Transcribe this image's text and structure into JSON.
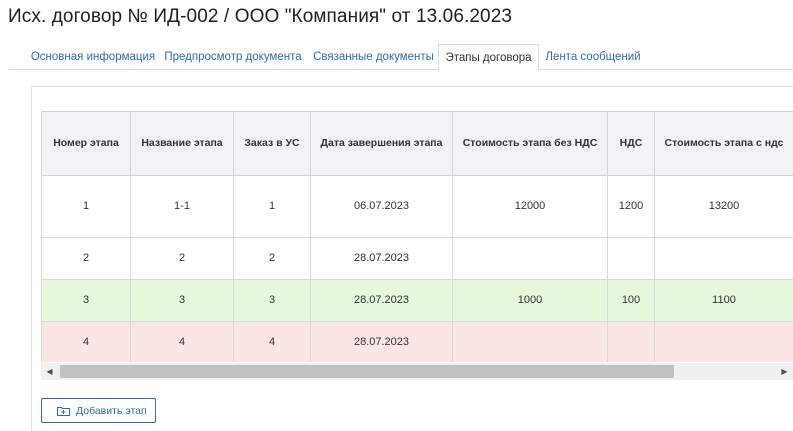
{
  "page": {
    "title": "Исх. договор № ИД-002 / ООО \"Компания\" от 13.06.2023"
  },
  "tabs": [
    {
      "label": "Основная информация",
      "active": false
    },
    {
      "label": "Предпросмотр документа",
      "active": false
    },
    {
      "label": "Связанные документы",
      "active": false
    },
    {
      "label": "Этапы договора",
      "active": true
    },
    {
      "label": "Лента сообщений",
      "active": false
    }
  ],
  "stages_table": {
    "columns": [
      "Номер этапа",
      "Название этапа",
      "Заказ в УС",
      "Дата завершения этапа",
      "Стоимость этапа без НДС",
      "НДС",
      "Стоимость этапа с ндс"
    ],
    "rows": [
      {
        "cells": [
          "1",
          "1-1",
          "1",
          "06.07.2023",
          "12000",
          "1200",
          "13200"
        ],
        "highlight": "none"
      },
      {
        "cells": [
          "2",
          "2",
          "2",
          "28.07.2023",
          "",
          "",
          ""
        ],
        "highlight": "none"
      },
      {
        "cells": [
          "3",
          "3",
          "3",
          "28.07.2023",
          "1000",
          "100",
          "1100"
        ],
        "highlight": "green"
      },
      {
        "cells": [
          "4",
          "4",
          "4",
          "28.07.2023",
          "",
          "",
          ""
        ],
        "highlight": "red"
      }
    ],
    "colors": {
      "header_bg": "#f2f3f4",
      "row_green": "#e7f8dd",
      "row_red": "#fbe6e6"
    }
  },
  "scrollbar": {
    "left_arrow": "◀",
    "right_arrow": "▶"
  },
  "actions": {
    "add_stage_label": "Добавить этап",
    "add_stage_icon": "folder-plus-icon"
  },
  "accent_color": "#2f6ca3"
}
